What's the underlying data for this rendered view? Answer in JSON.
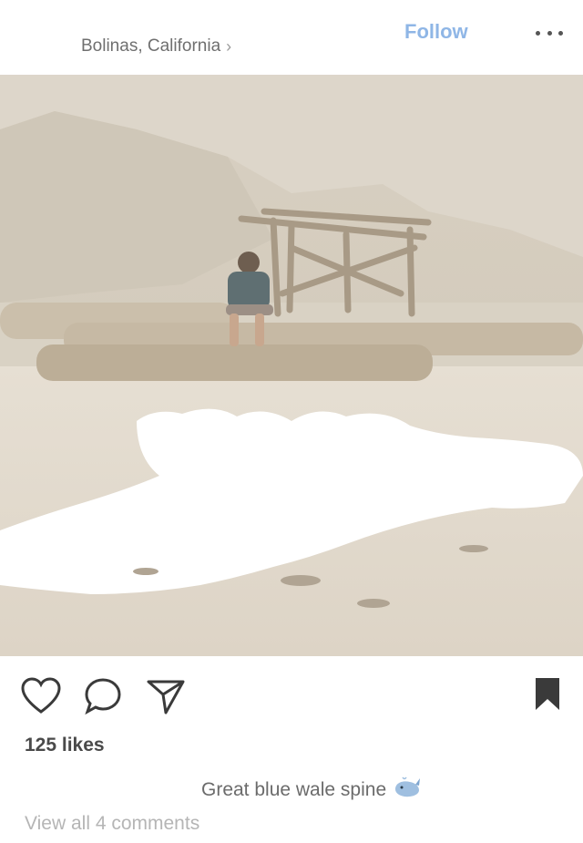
{
  "post": {
    "location": "Bolinas, California",
    "follow_label": "Follow",
    "likes_text": "125 likes",
    "caption": "Great blue wale spine",
    "view_comments": "View all 4 comments"
  },
  "icons": {
    "location_chevron": "chevron-right-icon",
    "more": "more-options-icon",
    "like": "heart-icon",
    "comment": "comment-bubble-icon",
    "share": "paper-plane-icon",
    "save": "bookmark-icon",
    "caption_emoji": "whale-icon"
  },
  "colors": {
    "follow": "#8fb6e6",
    "text": "#262626",
    "muted": "#b5b5b5"
  }
}
